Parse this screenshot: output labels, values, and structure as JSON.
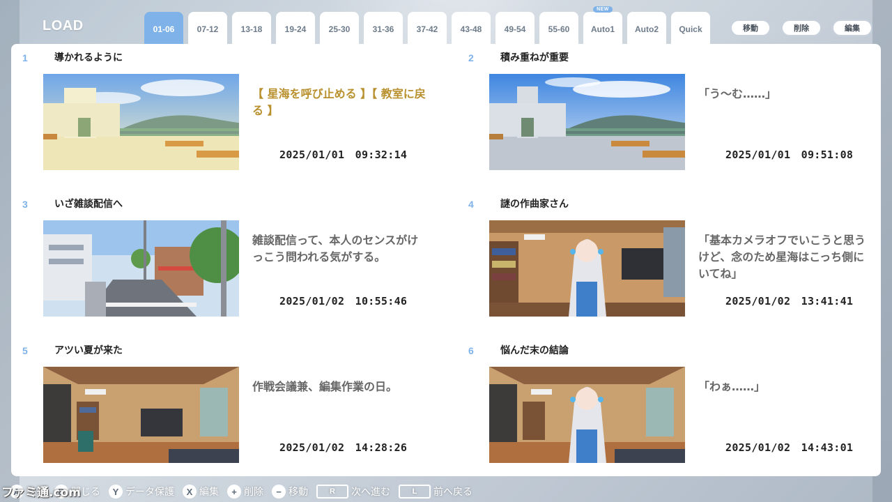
{
  "screen_title": "LOAD",
  "tabs": [
    {
      "label": "01-06",
      "active": true
    },
    {
      "label": "07-12"
    },
    {
      "label": "13-18"
    },
    {
      "label": "19-24"
    },
    {
      "label": "25-30"
    },
    {
      "label": "31-36"
    },
    {
      "label": "37-42"
    },
    {
      "label": "43-48"
    },
    {
      "label": "49-54"
    },
    {
      "label": "55-60"
    },
    {
      "label": "Auto1",
      "badge": "NEW"
    },
    {
      "label": "Auto2"
    },
    {
      "label": "Quick"
    }
  ],
  "actions": {
    "move": "移動",
    "delete": "削除",
    "edit": "編集"
  },
  "slots": [
    {
      "num": "1",
      "title": "導かれるように",
      "text": "【 星海を呼び止める 】【 教室に戻る 】",
      "date": "2025/01/01　09:32:14",
      "scene": "rooftop-warm"
    },
    {
      "num": "2",
      "title": "積み重ねが重要",
      "text": "「う〜む……」",
      "date": "2025/01/01　09:51:08",
      "scene": "rooftop"
    },
    {
      "num": "3",
      "title": "いざ雑談配信へ",
      "text": "雑談配信って、本人のセンスがけっこう問われる気がする。",
      "date": "2025/01/02　10:55:46",
      "scene": "street"
    },
    {
      "num": "4",
      "title": "謎の作曲家さん",
      "text": "「基本カメラオフでいこうと思うけど、念のため星海はこっち側にいてね」",
      "date": "2025/01/02　13:41:41",
      "scene": "room-girl"
    },
    {
      "num": "5",
      "title": "アツい夏が来た",
      "text": "作戦会議兼、編集作業の日。",
      "date": "2025/01/02　14:28:26",
      "scene": "room"
    },
    {
      "num": "6",
      "title": "悩んだ末の結論",
      "text": "「わぁ……」",
      "date": "2025/01/02　14:43:01",
      "scene": "room-girl"
    }
  ],
  "footer": {
    "a_label": "決定",
    "b_label": "閉じる",
    "y_label": "データ保護",
    "x_label": "編集",
    "plus_label": "削除",
    "minus_label": "移動",
    "r_key": "R",
    "r_label": "次へ進む",
    "l_key": "L",
    "l_label": "前へ戻る"
  },
  "watermark": "ファミ通.com",
  "colors": {
    "accent": "#7eb2e8",
    "choice_text": "#b8902d",
    "body_text": "#666666"
  }
}
